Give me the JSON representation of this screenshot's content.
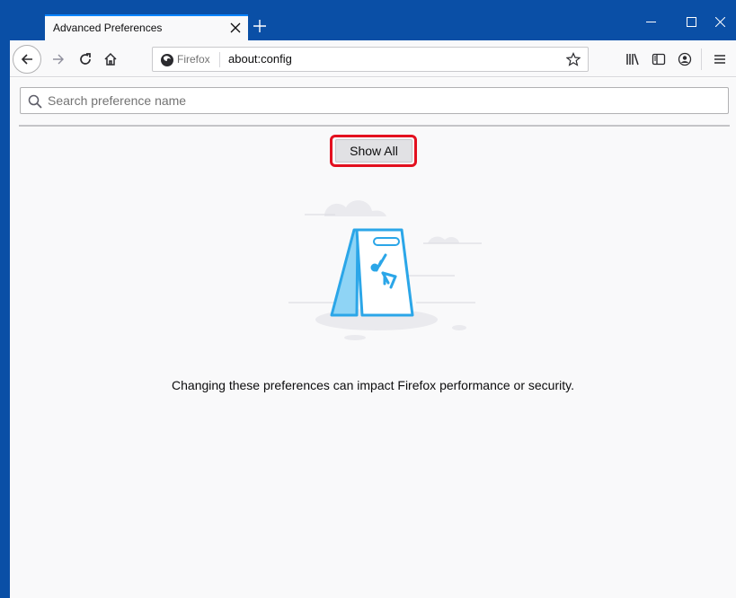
{
  "window": {
    "tab_title": "Advanced Preferences",
    "tab_close_icon": "close-icon",
    "new_tab_icon": "plus-icon",
    "controls": [
      "minimize-icon",
      "maximize-icon",
      "close-icon"
    ]
  },
  "navbar": {
    "identity_label": "Firefox",
    "url": "about:config",
    "icons": [
      "back-arrow-icon",
      "forward-arrow-icon",
      "reload-icon",
      "home-icon",
      "bookmark-star-icon",
      "library-icon",
      "sidebar-icon",
      "account-icon",
      "menu-icon"
    ]
  },
  "content": {
    "search_placeholder": "Search preference name",
    "search_value": "",
    "show_all_label": "Show All",
    "warning_text": "Changing these preferences can impact Firefox performance or security.",
    "illustration": "warning-sign-illustration"
  },
  "colors": {
    "titlebar": "#0a4fa6",
    "accent": "#0a84ff",
    "highlight_border": "#e3101f",
    "illustration_blue": "#2ba6e8"
  }
}
